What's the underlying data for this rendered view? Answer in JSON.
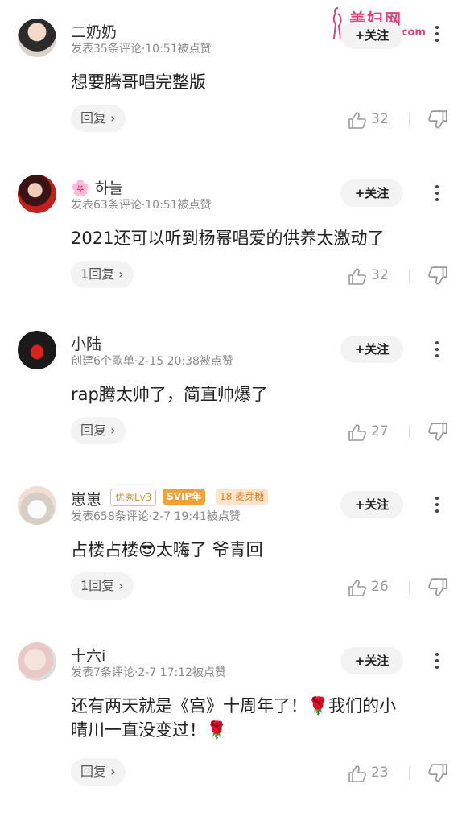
{
  "watermark": {
    "title": "美妇网",
    "url": "meifu43.com"
  },
  "comments": [
    {
      "name": "二奶奶",
      "meta": "发表35条评论·10:51被点赞",
      "follow": "+关注",
      "text": "想要腾哥唱完整版",
      "reply": "回复 ›",
      "likes": "32"
    },
    {
      "name_emoji": "🌸",
      "name": "하늘",
      "meta": "发表63条评论·10:51被点赞",
      "follow": "+关注",
      "text": "2021还可以听到杨幂唱爱的供养太激动了",
      "reply": "1回复 ›",
      "likes": "32"
    },
    {
      "name": "小陆",
      "meta": "创建6个歌单·2-15 20:38被点赞",
      "follow": "+关注",
      "text": "rap腾太帅了，简直帅爆了",
      "reply": "回复 ›",
      "likes": "27"
    },
    {
      "name": "崽崽",
      "badges": [
        "优秀Lv3",
        "SVIP年",
        "18 麦芽糖"
      ],
      "meta": "发表658条评论·2-7 19:41被点赞",
      "follow": "+关注",
      "text_a": "占楼占楼",
      "text_emoji": "😎",
      "text_b": "太嗨了 爷青回",
      "reply": "1回复 ›",
      "likes": "26"
    },
    {
      "name": "十六i",
      "meta": "发表7条评论·2-7 17:12被点赞",
      "follow": "+关注",
      "line1_a": "还有两天就是《宫》十周年了！",
      "line1_emoji": "🌹",
      "line1_b": "我们的小",
      "line2_a": "晴川一直没变过！",
      "line2_emoji": "🌹",
      "reply": "回复 ›",
      "likes": "23"
    }
  ],
  "colors": {
    "accent": "#e0407a",
    "svip": "#f0a23a",
    "muted": "#8a8a8a"
  }
}
